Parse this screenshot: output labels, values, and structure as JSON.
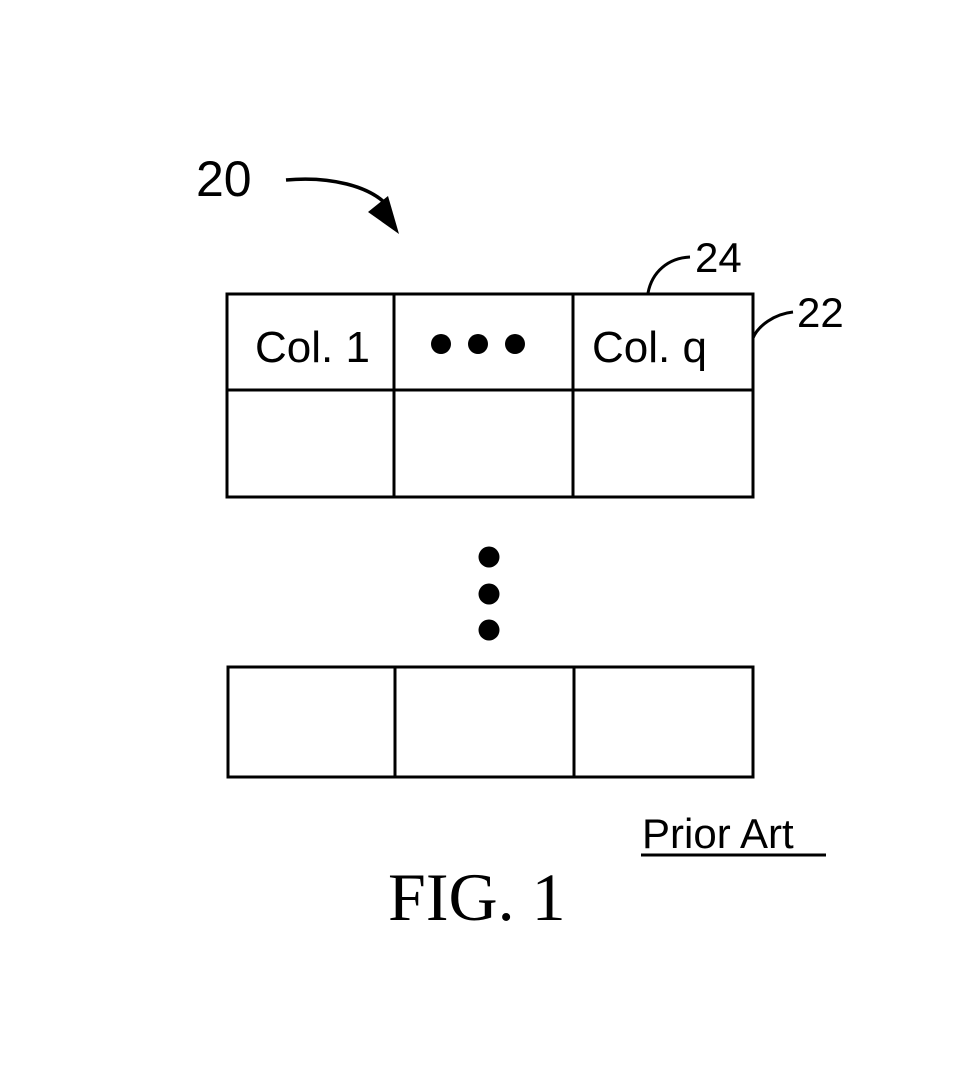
{
  "figure": {
    "title": "FIG. 1",
    "note": "Prior Art",
    "ref_labels": {
      "table": "20",
      "table_body": "22",
      "header_row": "24"
    },
    "header_cells": [
      "Col. 1",
      "•••",
      "Col. q"
    ],
    "ellipsis_vertical": "vertical-ellipsis",
    "rows_shown": 2,
    "columns_shown": 3
  }
}
